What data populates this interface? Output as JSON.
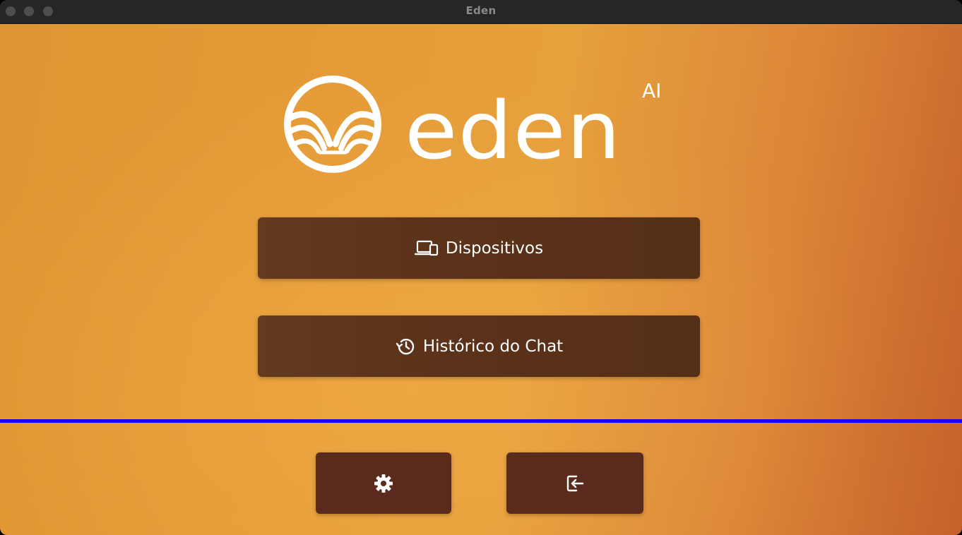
{
  "window": {
    "title": "Eden"
  },
  "logo": {
    "wordmark": "eden",
    "superscript": "AI"
  },
  "menu": {
    "devices_label": "Dispositivos",
    "history_label": "Histórico do Chat"
  },
  "icons": {
    "devices": "devices-icon",
    "history": "history-icon",
    "settings": "gear-icon",
    "logout": "logout-icon"
  },
  "colors": {
    "button": "#5a3119",
    "divider": "#1400ff",
    "background_start": "#e09433",
    "background_end": "#c4612a"
  }
}
